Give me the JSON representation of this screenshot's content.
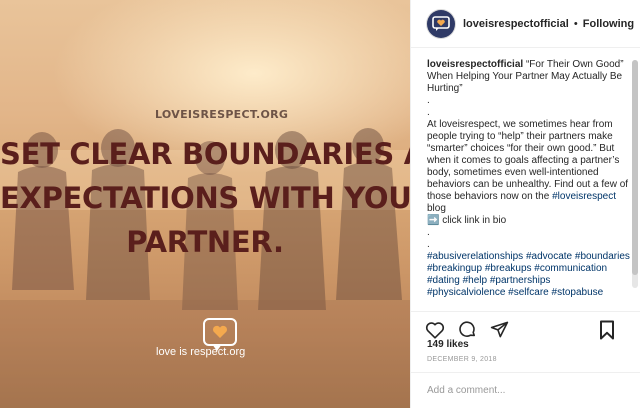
{
  "image": {
    "site_label": "LOVEISRESPECT.ORG",
    "headline_lines": [
      "SET CLEAR BOUNDARIES AND",
      "EXPECTATIONS WITH YOUR",
      "PARTNER."
    ],
    "brand_text": "love is respect.org",
    "colors": {
      "headline": "#5a1f1c",
      "logo_heart": "#f4a94e"
    }
  },
  "header": {
    "username": "loveisrespectofficial",
    "separator": "•",
    "follow_status": "Following"
  },
  "caption": {
    "username": "loveisrespectofficial",
    "title": "“For Their Own Good” When Helping Your Partner May Actually Be Hurting”",
    "dot1": ".",
    "dot2": ".",
    "body": "At loveisrespect, we sometimes hear from people trying to “help” their partners make “smarter” choices “for their own good.” But when it comes to goals affecting a partner’s body, sometimes even well-intentioned behaviors can be unhealthy. Find out a few of those behaviors now on the",
    "body_tag": "#loveisrespect",
    "body_end": "blog",
    "link_arrow": "➡️",
    "link_text": "click link in bio",
    "dot3": ".",
    "dot4": ".",
    "hashtags": "#abusiverelationships #advocate #boundaries #breakingup #breakups #communication #dating #help #partnerships #physicalviolence #selfcare #stopabuse"
  },
  "actions": {
    "icons": [
      "heart-icon",
      "comment-icon",
      "share-icon",
      "bookmark-icon"
    ]
  },
  "likes": "149 likes",
  "date": "DECEMBER 9, 2018",
  "comment": {
    "placeholder": "Add a comment..."
  }
}
